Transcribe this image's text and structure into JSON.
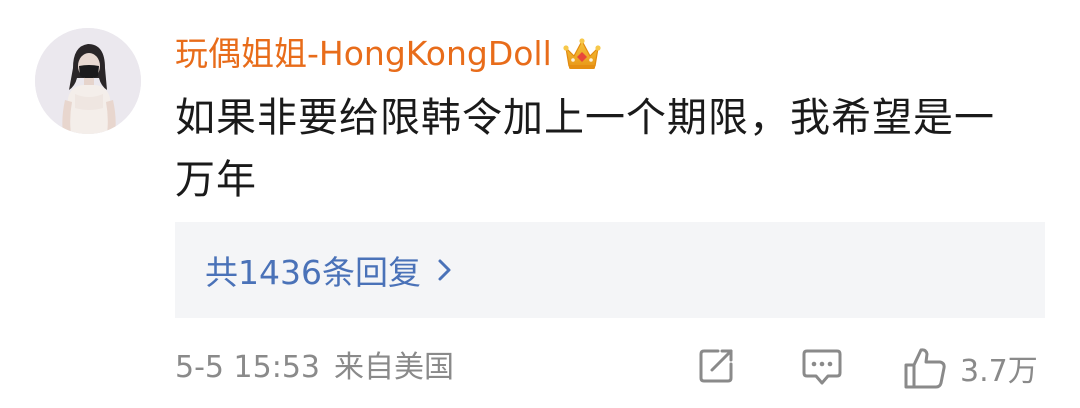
{
  "comment": {
    "username": "玩偶姐姐-HongKongDoll",
    "badge_icon": "crown-badge-icon",
    "text": "如果非要给限韩令加上一个期限，我希望是一万年",
    "replies_label": "共1436条回复",
    "date": "5-5 15:53",
    "location": "来自美国",
    "like_count": "3.7万"
  },
  "icons": [
    "share-icon",
    "comment-icon",
    "like-icon",
    "chevron-right-icon"
  ],
  "colors": {
    "username": "#e86c1a",
    "replies_link": "#4a72b8",
    "meta_text": "#8a8a8a",
    "replies_bg": "#f4f5f7"
  }
}
